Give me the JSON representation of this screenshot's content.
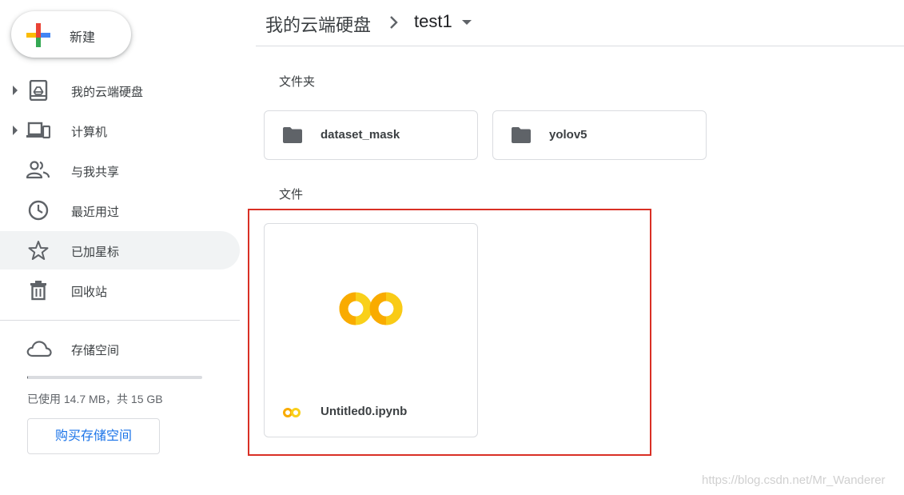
{
  "sidebar": {
    "new_button": {
      "label": "新建"
    },
    "items": [
      {
        "label": "我的云端硬盘",
        "icon": "drive-icon",
        "expandable": true,
        "active": false
      },
      {
        "label": "计算机",
        "icon": "computer-icon",
        "expandable": true,
        "active": false
      },
      {
        "label": "与我共享",
        "icon": "people-icon",
        "expandable": false,
        "active": false
      },
      {
        "label": "最近用过",
        "icon": "clock-icon",
        "expandable": false,
        "active": false
      },
      {
        "label": "已加星标",
        "icon": "star-icon",
        "expandable": false,
        "active": true
      },
      {
        "label": "回收站",
        "icon": "trash-icon",
        "expandable": false,
        "active": false
      }
    ],
    "storage": {
      "label": "存储空间",
      "icon": "cloud-icon",
      "usage_text": "已使用 14.7 MB，共 15 GB",
      "used_fraction": 0.001,
      "buy_button": "购买存储空间"
    }
  },
  "breadcrumb": {
    "root": "我的云端硬盘",
    "current": "test1"
  },
  "main": {
    "folders_title": "文件夹",
    "folders": [
      {
        "name": "dataset_mask",
        "icon": "folder-icon"
      },
      {
        "name": "yolov5",
        "icon": "folder-icon"
      }
    ],
    "files_title": "文件",
    "files": [
      {
        "name": "Untitled0.ipynb",
        "icon": "colab-icon"
      }
    ]
  },
  "watermark": "https://blog.csdn.net/Mr_Wanderer",
  "colors": {
    "accent_blue": "#1a73e8",
    "colab_yellow": "#f9ab00",
    "colab_light_yellow": "#f9d01a",
    "highlight_red": "#d93025",
    "active_bg": "#f1f3f4"
  }
}
